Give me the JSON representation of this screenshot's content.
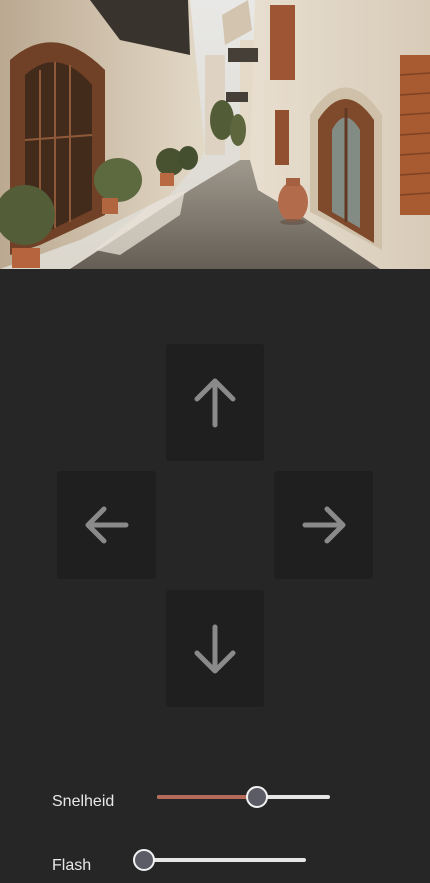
{
  "camera_preview": {
    "description_icon": "street-photo"
  },
  "controls": {
    "up_icon": "arrow-up-icon",
    "left_icon": "arrow-left-icon",
    "right_icon": "arrow-right-icon",
    "down_icon": "arrow-down-icon"
  },
  "speed": {
    "label": "Snelheid",
    "value": 0.58,
    "fill_color": "#b56a5a"
  },
  "flash": {
    "label": "Flash",
    "value": 0.0
  },
  "colors": {
    "background": "#262626",
    "button": "#1f1f1f",
    "arrow": "#8a8a8a"
  }
}
